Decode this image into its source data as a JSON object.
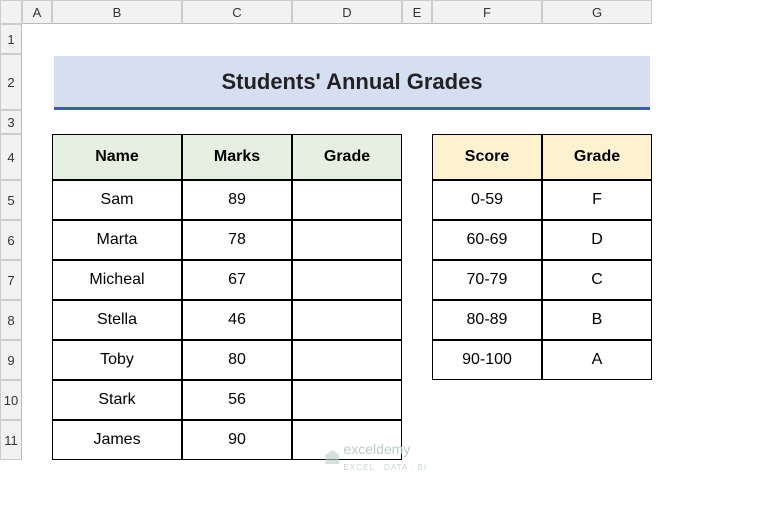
{
  "columns": [
    "A",
    "B",
    "C",
    "D",
    "E",
    "F",
    "G"
  ],
  "rows": [
    "1",
    "2",
    "3",
    "4",
    "5",
    "6",
    "7",
    "8",
    "9",
    "10",
    "11"
  ],
  "title": "Students' Annual Grades",
  "main_table": {
    "headers": {
      "name": "Name",
      "marks": "Marks",
      "grade": "Grade"
    },
    "rows": [
      {
        "name": "Sam",
        "marks": "89",
        "grade": ""
      },
      {
        "name": "Marta",
        "marks": "78",
        "grade": ""
      },
      {
        "name": "Micheal",
        "marks": "67",
        "grade": ""
      },
      {
        "name": "Stella",
        "marks": "46",
        "grade": ""
      },
      {
        "name": "Toby",
        "marks": "80",
        "grade": ""
      },
      {
        "name": "Stark",
        "marks": "56",
        "grade": ""
      },
      {
        "name": "James",
        "marks": "90",
        "grade": ""
      }
    ]
  },
  "key_table": {
    "headers": {
      "score": "Score",
      "grade": "Grade"
    },
    "rows": [
      {
        "score": "0-59",
        "grade": "F"
      },
      {
        "score": "60-69",
        "grade": "D"
      },
      {
        "score": "70-79",
        "grade": "C"
      },
      {
        "score": "80-89",
        "grade": "B"
      },
      {
        "score": "90-100",
        "grade": "A"
      }
    ]
  },
  "watermark": {
    "brand": "exceldemy",
    "tag": "EXCEL . DATA . BI"
  },
  "chart_data": {
    "type": "table",
    "title": "Students' Annual Grades",
    "series": [
      {
        "name": "Name",
        "values": [
          "Sam",
          "Marta",
          "Micheal",
          "Stella",
          "Toby",
          "Stark",
          "James"
        ]
      },
      {
        "name": "Marks",
        "values": [
          89,
          78,
          67,
          46,
          80,
          56,
          90
        ]
      },
      {
        "name": "Grade",
        "values": [
          "",
          "",
          "",
          "",
          "",
          "",
          ""
        ]
      }
    ],
    "lookup": {
      "headers": [
        "Score",
        "Grade"
      ],
      "rows": [
        [
          "0-59",
          "F"
        ],
        [
          "60-69",
          "D"
        ],
        [
          "70-79",
          "C"
        ],
        [
          "80-89",
          "B"
        ],
        [
          "90-100",
          "A"
        ]
      ]
    }
  }
}
